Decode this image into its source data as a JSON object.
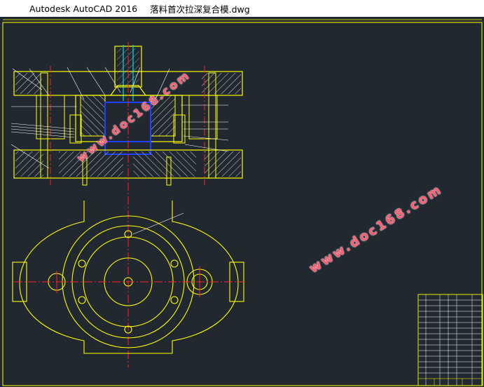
{
  "window": {
    "app_title": "Autodesk AutoCAD 2016",
    "file_name": "落料首次拉深复合模.dwg"
  },
  "watermarks": [
    "www.doc168.com",
    "www.doc168.com"
  ],
  "colors": {
    "background": "#212830",
    "outline": "#ffff00",
    "centerline": "#ff2020",
    "hatch": "#ffffff",
    "cyan": "#00e0e0",
    "blue": "#2040ff",
    "watermark": "#ff5a6e"
  }
}
